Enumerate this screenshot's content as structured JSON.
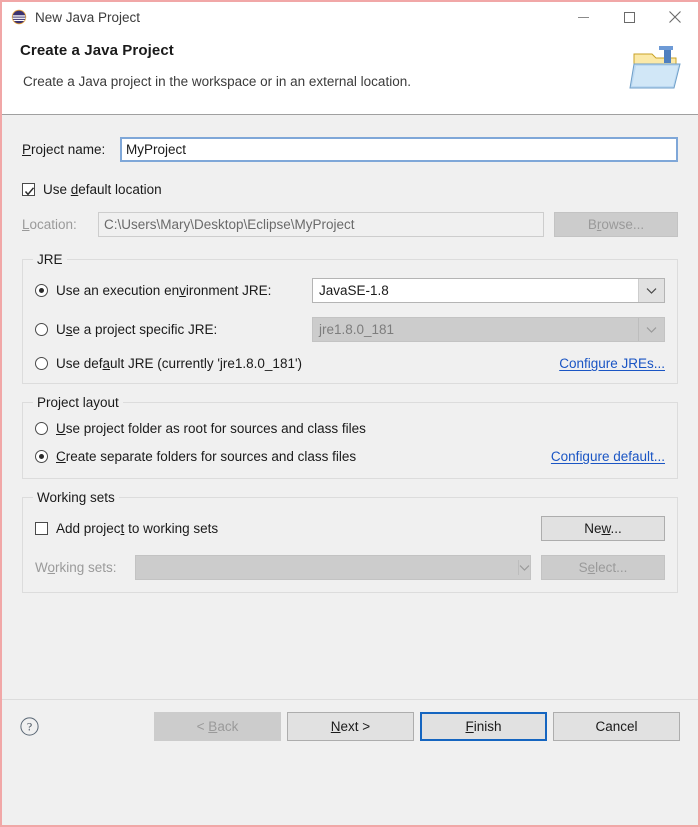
{
  "window": {
    "title": "New Java Project",
    "icon": "eclipse-logo-icon",
    "border_color": "#f1a7a7",
    "controls": {
      "minimize": "minimize-icon",
      "maximize": "maximize-icon",
      "close": "close-icon"
    }
  },
  "header": {
    "title": "Create a Java Project",
    "subtitle": "Create a Java project in the workspace or in an external location.",
    "icon": "java-project-folder-icon"
  },
  "form": {
    "project_name": {
      "label_pre": "",
      "label_mnemonic": "P",
      "label_post": "roject name:",
      "value": "MyProject",
      "placeholder": ""
    },
    "use_default_location": {
      "label_pre": "Use ",
      "label_mnemonic": "d",
      "label_post": "efault location",
      "checked": true
    },
    "location": {
      "label_pre": "",
      "label_mnemonic": "L",
      "label_post": "ocation:",
      "value": "C:\\Users\\Mary\\Desktop\\Eclipse\\MyProject",
      "enabled": false
    },
    "browse_button": {
      "label_pre": "B",
      "label_mnemonic": "r",
      "label_post": "owse...",
      "enabled": false
    }
  },
  "jre_group": {
    "title": "JRE",
    "options": [
      {
        "label_pre": "Use an execution en",
        "label_mnemonic": "v",
        "label_post": "ironment JRE:",
        "selected": true
      },
      {
        "label_pre": "U",
        "label_mnemonic": "s",
        "label_post": "e a project specific JRE:",
        "selected": false
      },
      {
        "label_pre": "Use def",
        "label_mnemonic": "a",
        "label_post": "ult JRE (currently 'jre1.8.0_181')",
        "selected": false
      }
    ],
    "execution_env_combo": {
      "value": "JavaSE-1.8",
      "enabled": true,
      "arrow": "chevron-down-icon"
    },
    "specific_jre_combo": {
      "value": "jre1.8.0_181",
      "enabled": false,
      "arrow": "chevron-down-icon"
    },
    "configure_link": "Configure JREs..."
  },
  "layout_group": {
    "title": "Project layout",
    "options": [
      {
        "label_pre": "",
        "label_mnemonic": "U",
        "label_post": "se project folder as root for sources and class files",
        "selected": false
      },
      {
        "label_pre": "",
        "label_mnemonic": "C",
        "label_post": "reate separate folders for sources and class files",
        "selected": true
      }
    ],
    "configure_link": "Configure default..."
  },
  "working_sets_group": {
    "title": "Working sets",
    "add_checkbox": {
      "label_pre": "Add projec",
      "label_mnemonic": "t",
      "label_post": " to working sets",
      "checked": false
    },
    "working_sets_label": {
      "label_pre": "W",
      "label_mnemonic": "o",
      "label_post": "rking sets:"
    },
    "working_sets_combo": {
      "value": "",
      "enabled": false,
      "arrow": "chevron-down-icon"
    },
    "new_button": {
      "label_pre": "Ne",
      "label_mnemonic": "w",
      "label_post": "...",
      "enabled": true
    },
    "select_button": {
      "label_pre": "S",
      "label_mnemonic": "e",
      "label_post": "lect...",
      "enabled": false
    }
  },
  "footer": {
    "help_icon": "help-question-icon",
    "back_button": {
      "label_pre": "< ",
      "label_mnemonic": "B",
      "label_post": "ack",
      "enabled": false
    },
    "next_button": {
      "label_pre": "",
      "label_mnemonic": "N",
      "label_post": "ext >",
      "enabled": true
    },
    "finish_button": {
      "label_pre": "",
      "label_mnemonic": "F",
      "label_post": "inish",
      "enabled": true,
      "is_default": true
    },
    "cancel_button": {
      "label_pre": "Cancel",
      "label_mnemonic": "",
      "label_post": "",
      "enabled": true
    }
  },
  "colors": {
    "accent_link": "#1a55c4",
    "focus_border": "#7fa7d8",
    "default_button_border": "#1565c0",
    "dialog_bg": "#f0f0f0",
    "window_border": "#f1a7a7"
  }
}
